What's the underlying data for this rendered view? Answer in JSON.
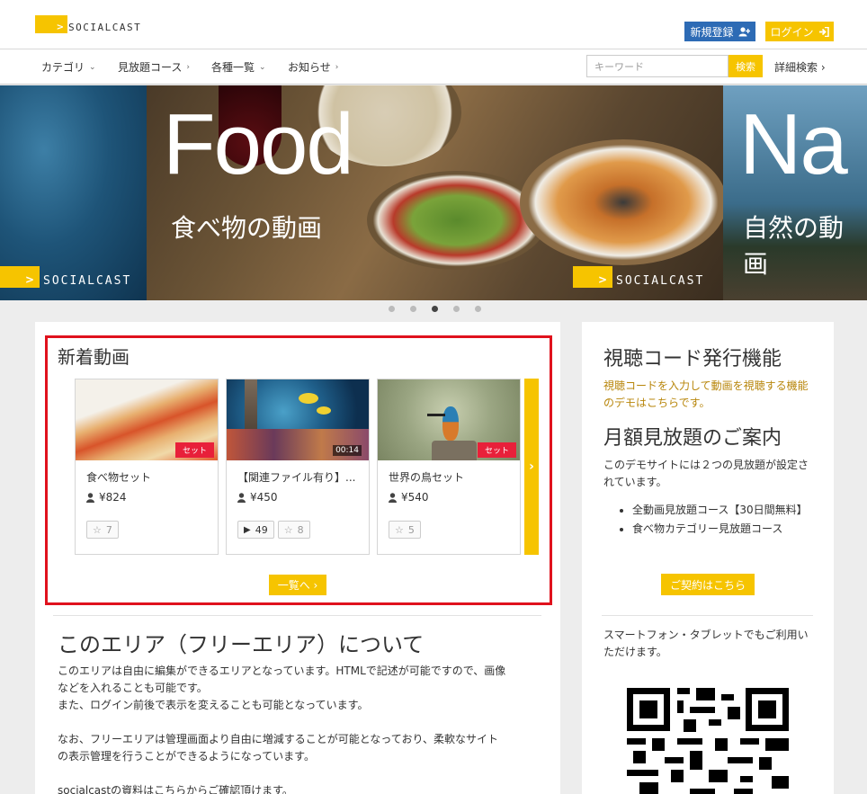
{
  "header": {
    "logo_mark": ">",
    "logo_text": "SOCIALCAST",
    "register_label": "新規登録",
    "login_label": "ログイン"
  },
  "nav": {
    "items": [
      {
        "label": "カテゴリ",
        "chevron": "⌄"
      },
      {
        "label": "見放題コース",
        "chevron": "›"
      },
      {
        "label": "各種一覧",
        "chevron": "⌄"
      },
      {
        "label": "お知らせ",
        "chevron": "›"
      }
    ],
    "search_placeholder": "キーワード",
    "search_button": "検索",
    "advanced_search": "詳細検索 ›"
  },
  "hero": {
    "center_big": "Food",
    "center_sub": "食べ物の動画",
    "right_big": "Na",
    "right_sub": "自然の動画",
    "logo_mark": ">",
    "logo_text": "SOCIALCAST",
    "dots_active_index": 2
  },
  "new_videos": {
    "title": "新着動画",
    "cards": [
      {
        "title": "食べ物セット",
        "price": "¥824",
        "badge": "セット",
        "stats": [
          {
            "icon": "star-icon",
            "value": "7"
          }
        ]
      },
      {
        "title": "【関連ファイル有り】...",
        "price": "¥450",
        "duration": "00:14",
        "stats": [
          {
            "icon": "play-icon",
            "value": "49"
          },
          {
            "icon": "star-icon",
            "value": "8"
          }
        ]
      },
      {
        "title": "世界の鳥セット",
        "price": "¥540",
        "badge": "セット",
        "stats": [
          {
            "icon": "star-icon",
            "value": "5"
          }
        ]
      }
    ],
    "list_button": "一覧へ ›"
  },
  "free_area": {
    "title": "このエリア（フリーエリア）について",
    "p1_line1": "このエリアは自由に編集ができるエリアとなっています。HTMLで記述が可能ですので、画像",
    "p1_line2": "などを入れることも可能です。",
    "p1_line3": "また、ログイン前後で表示を変えることも可能となっています。",
    "p2_line1": "なお、フリーエリアは管理画面より自由に増減することが可能となっており、柔軟なサイト",
    "p2_line2": "の表示管理を行うことができるようになっています。",
    "p3_line1": "socialcastの資料はこちらからご確認頂けます。"
  },
  "sidebar": {
    "code_title": "視聴コード発行機能",
    "code_link": "視聴コードを入力して動画を視聴する機能のデモはこちらです。",
    "monthly_title": "月額見放題のご案内",
    "monthly_text": "このデモサイトには２つの見放題が設定されています。",
    "courses": [
      "全動画見放題コース【30日間無料】",
      "食べ物カテゴリー見放題コース"
    ],
    "contract_button": "ご契約はこちら",
    "mobile_text": "スマートフォン・タブレットでもご利用いただけます。"
  },
  "colors": {
    "accent": "#f6c400",
    "register": "#2d6bb5",
    "highlight_border": "#e0121d",
    "badge": "#e8203a"
  }
}
